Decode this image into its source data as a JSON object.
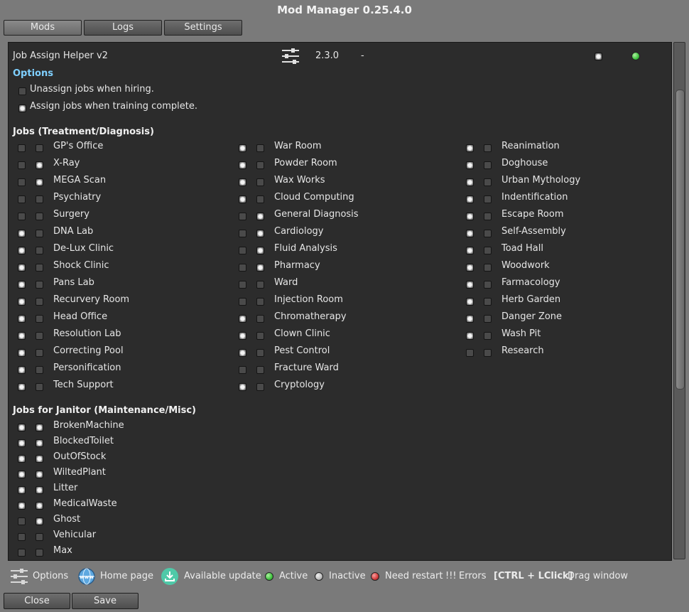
{
  "window": {
    "title": "Mod Manager 0.25.4.0"
  },
  "tabs": [
    {
      "label": "Mods"
    },
    {
      "label": "Logs"
    },
    {
      "label": "Settings"
    }
  ],
  "mod": {
    "name": "Job Assign Helper v2",
    "version": "2.3.0",
    "extra": "-",
    "enabled": true,
    "status_color": "#3fc23f"
  },
  "options": {
    "title": "Options",
    "items": [
      {
        "label": "Unassign jobs when hiring.",
        "checked": false
      },
      {
        "label": "Assign jobs when training complete.",
        "checked": true
      }
    ]
  },
  "jobs_treatment": {
    "title": "Jobs (Treatment/Diagnosis)",
    "columns": [
      [
        {
          "label": "GP's Office",
          "a": false,
          "b": false
        },
        {
          "label": "X-Ray",
          "a": false,
          "b": true
        },
        {
          "label": "MEGA Scan",
          "a": false,
          "b": true
        },
        {
          "label": "Psychiatry",
          "a": false,
          "b": false
        },
        {
          "label": "Surgery",
          "a": false,
          "b": false
        },
        {
          "label": "DNA Lab",
          "a": true,
          "b": false
        },
        {
          "label": "De-Lux Clinic",
          "a": true,
          "b": false
        },
        {
          "label": "Shock Clinic",
          "a": true,
          "b": false
        },
        {
          "label": "Pans Lab",
          "a": true,
          "b": false
        },
        {
          "label": "Recurvery Room",
          "a": true,
          "b": false
        },
        {
          "label": "Head Office",
          "a": true,
          "b": false
        },
        {
          "label": "Resolution Lab",
          "a": true,
          "b": false
        },
        {
          "label": "Correcting Pool",
          "a": true,
          "b": false
        },
        {
          "label": "Personification",
          "a": true,
          "b": false
        },
        {
          "label": "Tech Support",
          "a": true,
          "b": false
        }
      ],
      [
        {
          "label": "War Room",
          "a": true,
          "b": false
        },
        {
          "label": "Powder Room",
          "a": true,
          "b": false
        },
        {
          "label": "Wax Works",
          "a": true,
          "b": false
        },
        {
          "label": "Cloud Computing",
          "a": true,
          "b": false
        },
        {
          "label": "General Diagnosis",
          "a": false,
          "b": true
        },
        {
          "label": "Cardiology",
          "a": false,
          "b": true
        },
        {
          "label": "Fluid Analysis",
          "a": false,
          "b": true
        },
        {
          "label": "Pharmacy",
          "a": false,
          "b": true
        },
        {
          "label": "Ward",
          "a": false,
          "b": false
        },
        {
          "label": "Injection Room",
          "a": false,
          "b": false
        },
        {
          "label": "Chromatherapy",
          "a": true,
          "b": false
        },
        {
          "label": "Clown Clinic",
          "a": true,
          "b": false
        },
        {
          "label": "Pest Control",
          "a": true,
          "b": false
        },
        {
          "label": "Fracture Ward",
          "a": false,
          "b": false
        },
        {
          "label": "Cryptology",
          "a": true,
          "b": false
        }
      ],
      [
        {
          "label": "Reanimation",
          "a": true,
          "b": false
        },
        {
          "label": "Doghouse",
          "a": true,
          "b": false
        },
        {
          "label": "Urban Mythology",
          "a": true,
          "b": false
        },
        {
          "label": "Indentification",
          "a": true,
          "b": false
        },
        {
          "label": "Escape Room",
          "a": true,
          "b": false
        },
        {
          "label": "Self-Assembly",
          "a": true,
          "b": false
        },
        {
          "label": "Toad Hall",
          "a": true,
          "b": false
        },
        {
          "label": "Woodwork",
          "a": true,
          "b": false
        },
        {
          "label": "Farmacology",
          "a": true,
          "b": false
        },
        {
          "label": "Herb Garden",
          "a": true,
          "b": false
        },
        {
          "label": "Danger Zone",
          "a": true,
          "b": false
        },
        {
          "label": "Wash Pit",
          "a": true,
          "b": false
        },
        {
          "label": "Research",
          "a": false,
          "b": false
        }
      ]
    ]
  },
  "jobs_janitor": {
    "title": "Jobs for Janitor (Maintenance/Misc)",
    "items": [
      {
        "label": "BrokenMachine",
        "a": true,
        "b": true
      },
      {
        "label": "BlockedToilet",
        "a": true,
        "b": true
      },
      {
        "label": "OutOfStock",
        "a": true,
        "b": true
      },
      {
        "label": "WiltedPlant",
        "a": true,
        "b": true
      },
      {
        "label": "Litter",
        "a": true,
        "b": true
      },
      {
        "label": "MedicalWaste",
        "a": true,
        "b": true
      },
      {
        "label": "Ghost",
        "a": false,
        "b": true
      },
      {
        "label": "Vehicular",
        "a": false,
        "b": false
      },
      {
        "label": "Max",
        "a": false,
        "b": false
      }
    ]
  },
  "legend": {
    "options": "Options",
    "home_page": "Home page",
    "available_update": "Available update",
    "active": "Active",
    "inactive": "Inactive",
    "need_restart": "Need restart",
    "errors_mark": "!!!",
    "errors": "Errors",
    "shortcut": "[CTRL + LClick]",
    "drag_window": "Drag window",
    "colors": {
      "active": "#3fc23f",
      "inactive": "#bdbdbd",
      "need_restart": "#d33a3a",
      "update": "#4fc9a8",
      "globe": "#5ea8e0"
    }
  },
  "buttons": {
    "close": "Close",
    "save": "Save"
  }
}
